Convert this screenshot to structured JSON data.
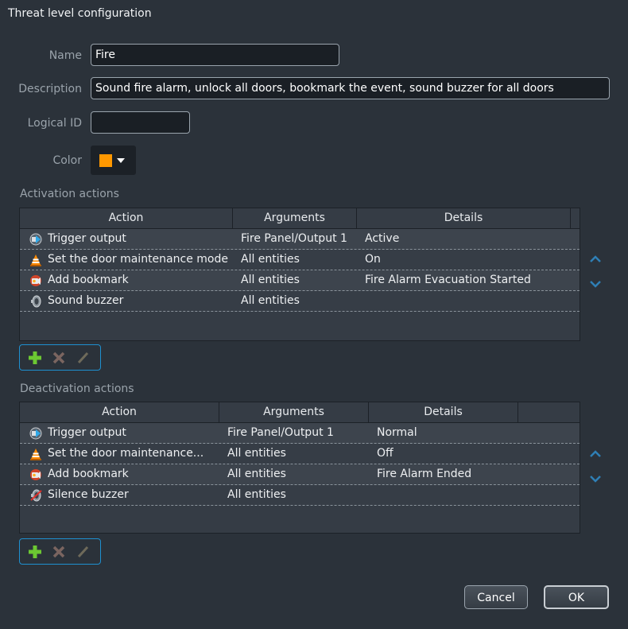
{
  "dialog": {
    "title": "Threat level configuration"
  },
  "form": {
    "name_label": "Name",
    "name_value": "Fire",
    "description_label": "Description",
    "description_value": "Sound fire alarm, unlock all doors, bookmark the event, sound buzzer for all doors",
    "logical_id_label": "Logical ID",
    "logical_id_value": "",
    "color_label": "Color",
    "color_value": "#ff9800"
  },
  "activation": {
    "label": "Activation actions",
    "columns": [
      "Action",
      "Arguments",
      "Details"
    ],
    "rows": [
      {
        "icon": "trigger-output-icon",
        "action": "Trigger output",
        "arguments": "Fire Panel/Output 1",
        "details": "Active"
      },
      {
        "icon": "maintenance-cone-icon",
        "action": "Set the door maintenance mode",
        "arguments": "All entities",
        "details": "On"
      },
      {
        "icon": "bookmark-icon",
        "action": "Add bookmark",
        "arguments": "All entities",
        "details": "Fire Alarm Evacuation Started"
      },
      {
        "icon": "buzzer-icon",
        "action": "Sound buzzer",
        "arguments": "All entities",
        "details": ""
      }
    ]
  },
  "deactivation": {
    "label": "Deactivation actions",
    "columns": [
      "Action",
      "Arguments",
      "Details"
    ],
    "rows": [
      {
        "icon": "trigger-output-icon",
        "action": "Trigger output",
        "arguments": "Fire Panel/Output 1",
        "details": "Normal"
      },
      {
        "icon": "maintenance-cone-icon",
        "action": "Set the door maintenance...",
        "arguments": "All entities",
        "details": "Off"
      },
      {
        "icon": "bookmark-icon",
        "action": "Add bookmark",
        "arguments": "All entities",
        "details": "Fire Alarm Ended"
      },
      {
        "icon": "silence-buzzer-icon",
        "action": "Silence buzzer",
        "arguments": "All entities",
        "details": ""
      }
    ]
  },
  "footer": {
    "cancel_label": "Cancel",
    "ok_label": "OK"
  }
}
